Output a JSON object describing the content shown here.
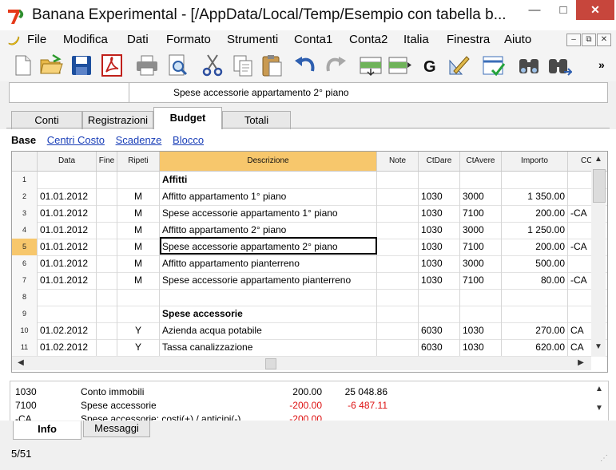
{
  "window": {
    "title": "Banana Experimental - [/AppData/Local/Temp/Esempio con tabella b...",
    "controls": {
      "minimize": "—",
      "maximize": "□",
      "close": "✕"
    }
  },
  "menu": {
    "items": [
      "File",
      "Modifica",
      "Dati",
      "Formato",
      "Strumenti",
      "Conta1",
      "Conta2",
      "Italia",
      "Finestra",
      "Aiuto"
    ],
    "mdi_controls": [
      "–",
      "⧉",
      "✕"
    ]
  },
  "toolbar": {
    "buttons": [
      "new-file",
      "open-folder",
      "save-disk",
      "pdf",
      "print",
      "print-preview",
      "cut",
      "copy",
      "paste",
      "undo",
      "redo",
      "add-row",
      "insert-rows",
      "go-to",
      "edit-tool",
      "check"
    ],
    "overflow": "»"
  },
  "formula_bar": {
    "cell_ref": "",
    "content": "Spese accessorie appartamento 2° piano"
  },
  "tabs": [
    "Conti",
    "Registrazioni",
    "Budget",
    "Totali"
  ],
  "active_tab": "Budget",
  "views": [
    "Base",
    "Centri Costo",
    "Scadenze",
    "Blocco"
  ],
  "grid": {
    "columns": [
      "Data",
      "Fine",
      "Ripeti",
      "Descrizione",
      "Note",
      "CtDare",
      "CtAvere",
      "Importo",
      "CC"
    ],
    "selected_row": "5",
    "rows": [
      {
        "n": "1",
        "data": "",
        "fine": "",
        "ripeti": "",
        "descrizione": "Affitti",
        "bold": true,
        "ctdare": "",
        "ctavere": "",
        "importo": "",
        "cc": ""
      },
      {
        "n": "2",
        "data": "01.01.2012",
        "fine": "",
        "ripeti": "M",
        "descrizione": "Affitto appartamento 1° piano",
        "ctdare": "1030",
        "ctavere": "3000",
        "importo": "1 350.00",
        "cc": ""
      },
      {
        "n": "3",
        "data": "01.01.2012",
        "fine": "",
        "ripeti": "M",
        "descrizione": "Spese accessorie appartamento 1° piano",
        "ctdare": "1030",
        "ctavere": "7100",
        "importo": "200.00",
        "cc": "-CA"
      },
      {
        "n": "4",
        "data": "01.01.2012",
        "fine": "",
        "ripeti": "M",
        "descrizione": "Affitto appartamento 2° piano",
        "ctdare": "1030",
        "ctavere": "3000",
        "importo": "1 250.00",
        "cc": ""
      },
      {
        "n": "5",
        "data": "01.01.2012",
        "fine": "",
        "ripeti": "M",
        "descrizione": "Spese accessorie appartamento 2° piano",
        "ctdare": "1030",
        "ctavere": "7100",
        "importo": "200.00",
        "cc": "-CA"
      },
      {
        "n": "6",
        "data": "01.01.2012",
        "fine": "",
        "ripeti": "M",
        "descrizione": "Affitto appartamento pianterreno",
        "ctdare": "1030",
        "ctavere": "3000",
        "importo": "500.00",
        "cc": ""
      },
      {
        "n": "7",
        "data": "01.01.2012",
        "fine": "",
        "ripeti": "M",
        "descrizione": "Spese accessorie appartamento pianterreno",
        "ctdare": "1030",
        "ctavere": "7100",
        "importo": "80.00",
        "cc": "-CA"
      },
      {
        "n": "8",
        "data": "",
        "fine": "",
        "ripeti": "",
        "descrizione": "",
        "ctdare": "",
        "ctavere": "",
        "importo": "",
        "cc": ""
      },
      {
        "n": "9",
        "data": "",
        "fine": "",
        "ripeti": "",
        "descrizione": "Spese accessorie",
        "bold": true,
        "ctdare": "",
        "ctavere": "",
        "importo": "",
        "cc": ""
      },
      {
        "n": "10",
        "data": "01.02.2012",
        "fine": "",
        "ripeti": "Y",
        "descrizione": "Azienda acqua potabile",
        "ctdare": "6030",
        "ctavere": "1030",
        "importo": "270.00",
        "cc": "CA"
      },
      {
        "n": "11",
        "data": "01.02.2012",
        "fine": "",
        "ripeti": "Y",
        "descrizione": "Tassa canalizzazione",
        "ctdare": "6030",
        "ctavere": "1030",
        "importo": "620.00",
        "cc": "CA"
      }
    ]
  },
  "info": {
    "rows": [
      {
        "code": "1030",
        "desc": "Conto immobili",
        "v1": "200.00",
        "v2": "25 048.86",
        "neg1": false,
        "neg2": false
      },
      {
        "code": "7100",
        "desc": "Spese accessorie",
        "v1": "-200.00",
        "v2": "-6 487.11",
        "neg1": true,
        "neg2": true
      },
      {
        "code": "-CA",
        "desc": "Spese accessorie: costi(+) / anticipi(-)",
        "v1": "-200.00",
        "v2": "",
        "neg1": true,
        "neg2": false
      }
    ]
  },
  "bottom_tabs": [
    "Info",
    "Messaggi"
  ],
  "status": {
    "position": "5/51"
  }
}
